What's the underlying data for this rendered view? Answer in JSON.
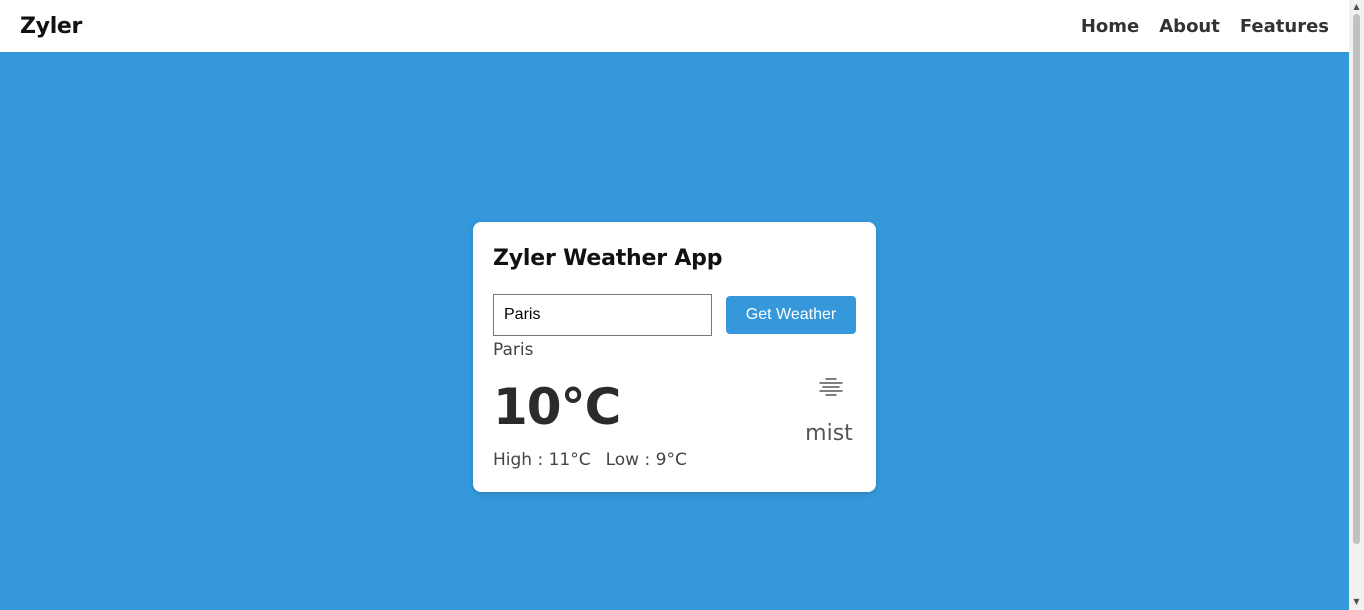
{
  "navbar": {
    "brand": "Zyler",
    "links": [
      "Home",
      "About",
      "Features"
    ]
  },
  "card": {
    "title": "Zyler Weather App",
    "input_value": "Paris",
    "button_label": "Get Weather",
    "city": "Paris",
    "temperature": "10°C",
    "high": "High : 11°C",
    "low": "Low : 9°C",
    "icon": "mist-icon",
    "description": "mist"
  },
  "colors": {
    "background": "#3498db",
    "button": "#3498db",
    "card": "#ffffff",
    "navbar": "#ffffff"
  }
}
